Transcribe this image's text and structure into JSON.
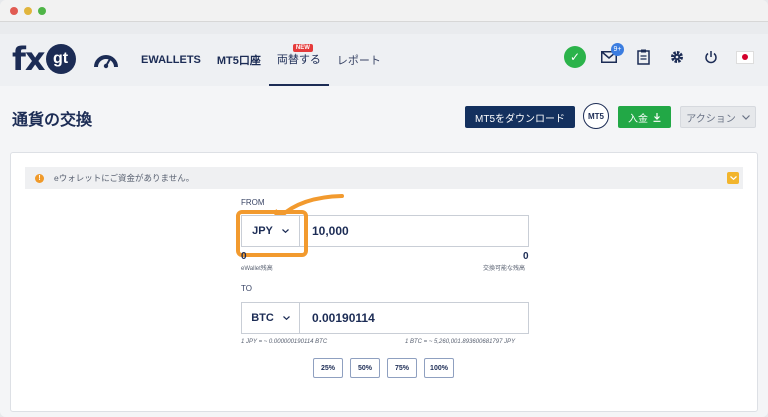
{
  "logo": {
    "fx": "fx",
    "gt": "gt"
  },
  "nav": {
    "items": [
      {
        "label": "EWALLETS"
      },
      {
        "label": "MT5口座"
      },
      {
        "label": "両替する",
        "badge": "NEW"
      },
      {
        "label": "レポート"
      }
    ]
  },
  "header_icons": {
    "mail_badge": "9+"
  },
  "page": {
    "title": "通貨の交換",
    "download_button": "MT5をダウンロード",
    "mt5_label": "MT5",
    "deposit_button": "入金",
    "action_button": "アクション"
  },
  "notice": {
    "icon": "!",
    "text": "eウォレットにご資金がありません。"
  },
  "converter": {
    "from_label": "FROM",
    "from_currency": "JPY",
    "from_amount": "10,000",
    "from_balance_value": "0",
    "from_balance_label": "eWallet残高",
    "from_available_value": "0",
    "from_available_label": "交換可能な残高",
    "to_label": "TO",
    "to_currency": "BTC",
    "to_amount": "0.00190114",
    "rate_left": "1 JPY = ~ 0.000000190114 BTC",
    "rate_right": "1 BTC = ~ 5,260,001.893600681797 JPY",
    "percent_buttons": [
      "25%",
      "50%",
      "75%",
      "100%"
    ]
  },
  "colors": {
    "navy": "#1c2c55",
    "green": "#22a846",
    "orange_highlight": "#f29a2e",
    "notice_icon": "#f09a2a"
  }
}
